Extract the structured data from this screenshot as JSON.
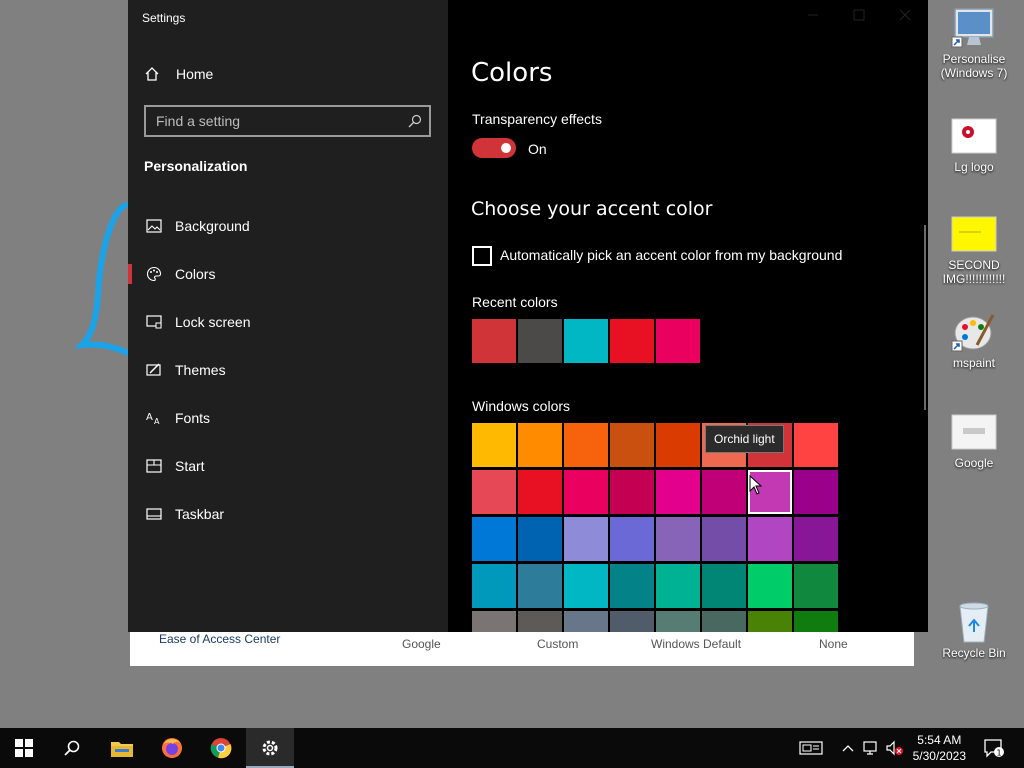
{
  "settings": {
    "title": "Settings",
    "home_label": "Home",
    "search_placeholder": "Find a setting",
    "section_title": "Personalization",
    "nav": [
      {
        "label": "Background",
        "icon": "picture-icon"
      },
      {
        "label": "Colors",
        "icon": "palette-icon",
        "active": true
      },
      {
        "label": "Lock screen",
        "icon": "lock-screen-icon"
      },
      {
        "label": "Themes",
        "icon": "themes-icon"
      },
      {
        "label": "Fonts",
        "icon": "fonts-icon"
      },
      {
        "label": "Start",
        "icon": "start-icon"
      },
      {
        "label": "Taskbar",
        "icon": "taskbar-icon"
      }
    ]
  },
  "colors_page": {
    "title": "Colors",
    "transparency_label": "Transparency effects",
    "transparency_state": "On",
    "accent_heading": "Choose your accent color",
    "auto_pick_label": "Automatically pick an accent color from my background",
    "recent_label": "Recent colors",
    "recent_colors": [
      "#d13438",
      "#4c4a48",
      "#00b7c3",
      "#e81123",
      "#ea005e"
    ],
    "windows_label": "Windows colors",
    "tooltip": "Orchid light",
    "windows_colors": [
      "#ffb900",
      "#ff8c00",
      "#f7630c",
      "#ca5010",
      "#da3b01",
      "#ef6950",
      "#d13438",
      "#ff4343",
      "#e74856",
      "#e81123",
      "#ea005e",
      "#c30052",
      "#e3008c",
      "#bf0077",
      "#c239b3",
      "#9a0089",
      "#0078d7",
      "#0063b1",
      "#8e8cd8",
      "#6b69d6",
      "#8764b8",
      "#744da9",
      "#b146c2",
      "#881798",
      "#0099bc",
      "#2d7d9a",
      "#00b7c3",
      "#038387",
      "#00b294",
      "#018574",
      "#00cc6a",
      "#10893e",
      "#7a7574",
      "#5d5a58",
      "#68768a",
      "#515c6b",
      "#567c73",
      "#486860",
      "#498205",
      "#107c10"
    ],
    "selected_index": 14
  },
  "background_window": {
    "labels": [
      "Ease of Access Center",
      "Google",
      "Custom",
      "Windows Default",
      "None"
    ]
  },
  "desktop_icons": [
    {
      "label": "Personalise (Windows 7)",
      "icon": "monitor-icon"
    },
    {
      "label": "Lg logo",
      "icon": "image-file-icon"
    },
    {
      "label": "SECOND IMG!!!!!!!!!!!!",
      "icon": "image-file-icon"
    },
    {
      "label": "mspaint",
      "icon": "paint-palette-icon"
    },
    {
      "label": "Google",
      "icon": "image-file-icon"
    },
    {
      "label": "Recycle Bin",
      "icon": "recycle-bin-icon"
    }
  ],
  "taskbar": {
    "time": "5:54 AM",
    "date": "5/30/2023",
    "notification_count": "1"
  },
  "accent": "#d13438"
}
